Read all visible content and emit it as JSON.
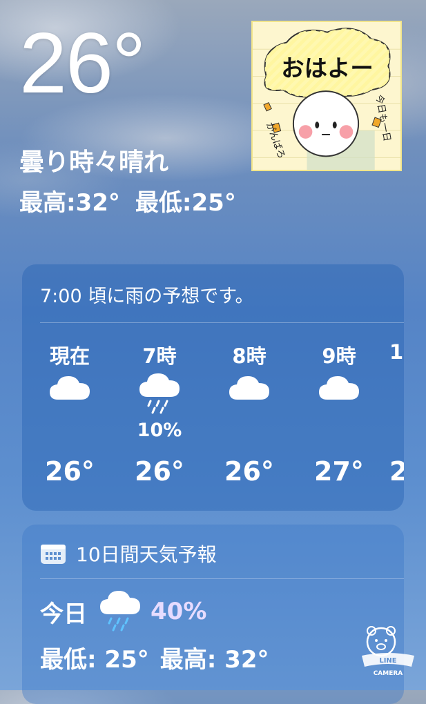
{
  "current": {
    "temperature": "26°",
    "condition": "曇り時々晴れ",
    "high": "最高:32°",
    "low": "最低:25°"
  },
  "sticker": {
    "greeting": "おはよー",
    "side_left": "がんばろ",
    "side_right": "今日も一日"
  },
  "hourly": {
    "message": "7:00 頃に雨の予想です。",
    "hours": [
      {
        "label": "現在",
        "icon": "cloud-icon",
        "precip": "",
        "temp": "26°"
      },
      {
        "label": "7時",
        "icon": "cloud-rain-icon",
        "precip": "10%",
        "temp": "26°"
      },
      {
        "label": "8時",
        "icon": "cloud-icon",
        "precip": "",
        "temp": "26°"
      },
      {
        "label": "9時",
        "icon": "cloud-icon",
        "precip": "",
        "temp": "27°"
      },
      {
        "label": "1",
        "icon": "",
        "precip": "",
        "temp": "2"
      }
    ]
  },
  "daily": {
    "header": "10日間天気予報",
    "today": {
      "name": "今日",
      "icon": "cloud-rain-icon",
      "precip": "40%",
      "low": "最低: 25°",
      "high": "最高: 32°"
    }
  },
  "watermark": {
    "line1": "LINE",
    "line2": "CAMERA"
  },
  "colors": {
    "precip_accent": "#e7dcff",
    "card_bg": "#2864b4"
  }
}
